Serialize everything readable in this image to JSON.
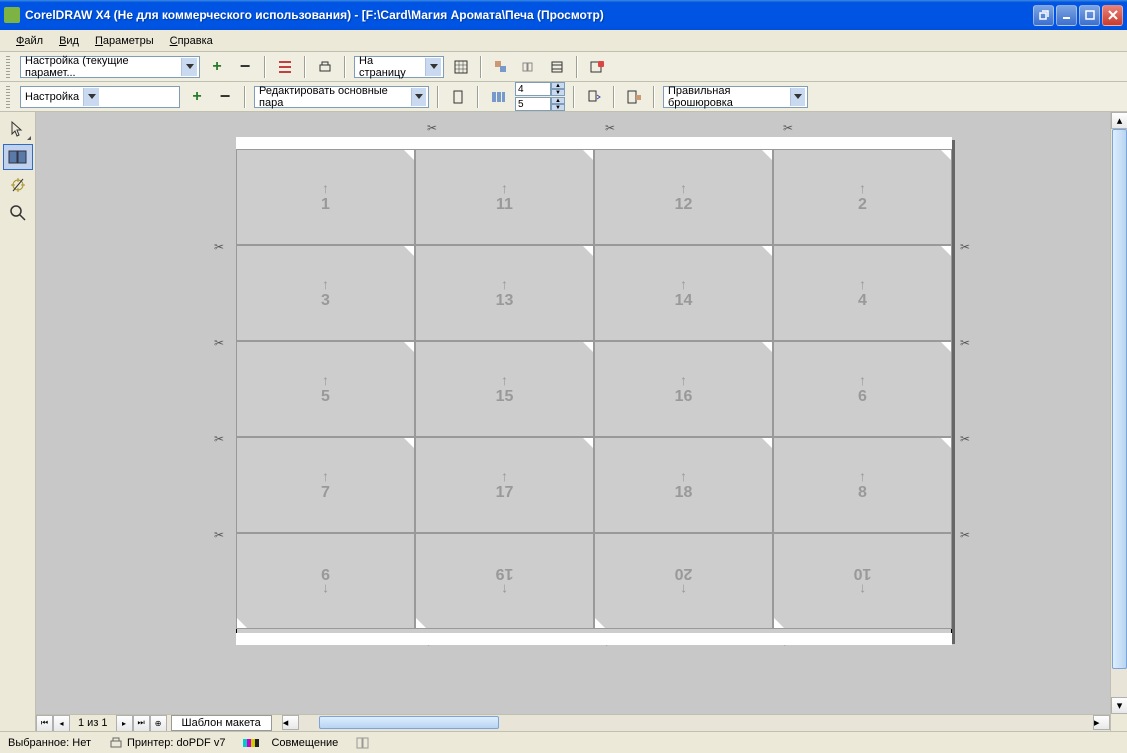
{
  "titlebar": {
    "title": "CorelDRAW X4 (Не для коммерческого использования) - [F:\\Card\\Магия Аромата\\Печа (Просмотр)"
  },
  "menu": {
    "file": "Файл",
    "view": "Вид",
    "params": "Параметры",
    "help": "Справка"
  },
  "toolbar1": {
    "preset": "Настройка (текущие парамет...",
    "fit": "На страницу"
  },
  "toolbar2": {
    "preset": "Настройка",
    "edit": "Редактировать основные пара",
    "spin1": "4",
    "spin2": "5",
    "binding": "Правильная брошюровка"
  },
  "cells": [
    {
      "n": "1",
      "flip": false
    },
    {
      "n": "11",
      "flip": false
    },
    {
      "n": "12",
      "flip": false
    },
    {
      "n": "2",
      "flip": false
    },
    {
      "n": "3",
      "flip": false
    },
    {
      "n": "13",
      "flip": false
    },
    {
      "n": "14",
      "flip": false
    },
    {
      "n": "4",
      "flip": false
    },
    {
      "n": "5",
      "flip": false
    },
    {
      "n": "15",
      "flip": false
    },
    {
      "n": "16",
      "flip": false
    },
    {
      "n": "6",
      "flip": false
    },
    {
      "n": "7",
      "flip": false
    },
    {
      "n": "17",
      "flip": false
    },
    {
      "n": "18",
      "flip": false
    },
    {
      "n": "8",
      "flip": false
    },
    {
      "n": "9",
      "flip": true
    },
    {
      "n": "19",
      "flip": true
    },
    {
      "n": "20",
      "flip": true
    },
    {
      "n": "10",
      "flip": true
    }
  ],
  "pagenav": {
    "info": "1 из 1",
    "tab": "Шаблон макета"
  },
  "status": {
    "selected": "Выбранное: Нет",
    "printer": "Принтер: doPDF v7",
    "registration": "Совмещение"
  }
}
